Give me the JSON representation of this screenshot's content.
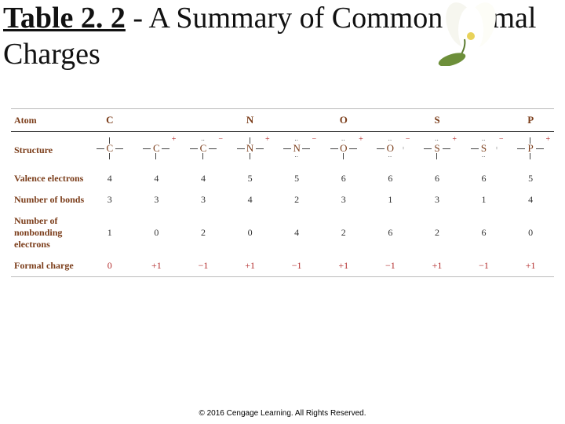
{
  "title": {
    "table_prefix": "Table 2. 2",
    "rest": " - A Summary of Common Formal Charges"
  },
  "row_headers": [
    "Atom",
    "Structure",
    "Valence electrons",
    "Number of bonds",
    "Number of nonbonding electrons",
    "Formal charge"
  ],
  "footer": "© 2016 Cengage Learning. All Rights Reserved.",
  "chart_data": {
    "type": "table",
    "title": "Table 2.2 - A Summary of Common Formal Charges",
    "columns": [
      {
        "atom": "C",
        "structure": {
          "symbol": "C",
          "bonds": [
            "l",
            "r",
            "t",
            "b"
          ],
          "lone_pairs": [],
          "charge": "0"
        },
        "valence_electrons": 4,
        "bonds": 3,
        "nonbonding_electrons": 1,
        "formal_charge": "0"
      },
      {
        "atom": "C",
        "structure": {
          "symbol": "C",
          "bonds": [
            "l",
            "r",
            "b"
          ],
          "lone_pairs": [],
          "charge": "+"
        },
        "valence_electrons": 4,
        "bonds": 3,
        "nonbonding_electrons": 0,
        "formal_charge": "+1"
      },
      {
        "atom": "C",
        "structure": {
          "symbol": "C",
          "bonds": [
            "l",
            "r",
            "b"
          ],
          "lone_pairs": [
            "top"
          ],
          "charge": "−"
        },
        "valence_electrons": 4,
        "bonds": 3,
        "nonbonding_electrons": 2,
        "formal_charge": "−1"
      },
      {
        "atom": "N",
        "structure": {
          "symbol": "N",
          "bonds": [
            "l",
            "r",
            "t",
            "b"
          ],
          "lone_pairs": [],
          "charge": "+"
        },
        "valence_electrons": 5,
        "bonds": 4,
        "nonbonding_electrons": 0,
        "formal_charge": "+1"
      },
      {
        "atom": "N",
        "structure": {
          "symbol": "N",
          "bonds": [
            "l",
            "r"
          ],
          "lone_pairs": [
            "top",
            "bot"
          ],
          "charge": "−"
        },
        "valence_electrons": 5,
        "bonds": 2,
        "nonbonding_electrons": 4,
        "formal_charge": "−1"
      },
      {
        "atom": "O",
        "structure": {
          "symbol": "O",
          "bonds": [
            "l",
            "r",
            "b"
          ],
          "lone_pairs": [
            "top"
          ],
          "charge": "+"
        },
        "valence_electrons": 6,
        "bonds": 3,
        "nonbonding_electrons": 2,
        "formal_charge": "+1"
      },
      {
        "atom": "O",
        "structure": {
          "symbol": "O",
          "bonds": [
            "l"
          ],
          "lone_pairs": [
            "top",
            "bot",
            "right"
          ],
          "charge": "−"
        },
        "valence_electrons": 6,
        "bonds": 1,
        "nonbonding_electrons": 6,
        "formal_charge": "−1"
      },
      {
        "atom": "S",
        "structure": {
          "symbol": "S",
          "bonds": [
            "l",
            "r",
            "b"
          ],
          "lone_pairs": [
            "top"
          ],
          "charge": "+"
        },
        "valence_electrons": 6,
        "bonds": 3,
        "nonbonding_electrons": 2,
        "formal_charge": "+1"
      },
      {
        "atom": "S",
        "structure": {
          "symbol": "S",
          "bonds": [
            "l"
          ],
          "lone_pairs": [
            "top",
            "bot",
            "right"
          ],
          "charge": "−"
        },
        "valence_electrons": 6,
        "bonds": 1,
        "nonbonding_electrons": 6,
        "formal_charge": "−1"
      },
      {
        "atom": "P",
        "structure": {
          "symbol": "P",
          "bonds": [
            "l",
            "r",
            "t",
            "b"
          ],
          "lone_pairs": [],
          "charge": "+"
        },
        "valence_electrons": 5,
        "bonds": 4,
        "nonbonding_electrons": 0,
        "formal_charge": "+1"
      }
    ]
  }
}
